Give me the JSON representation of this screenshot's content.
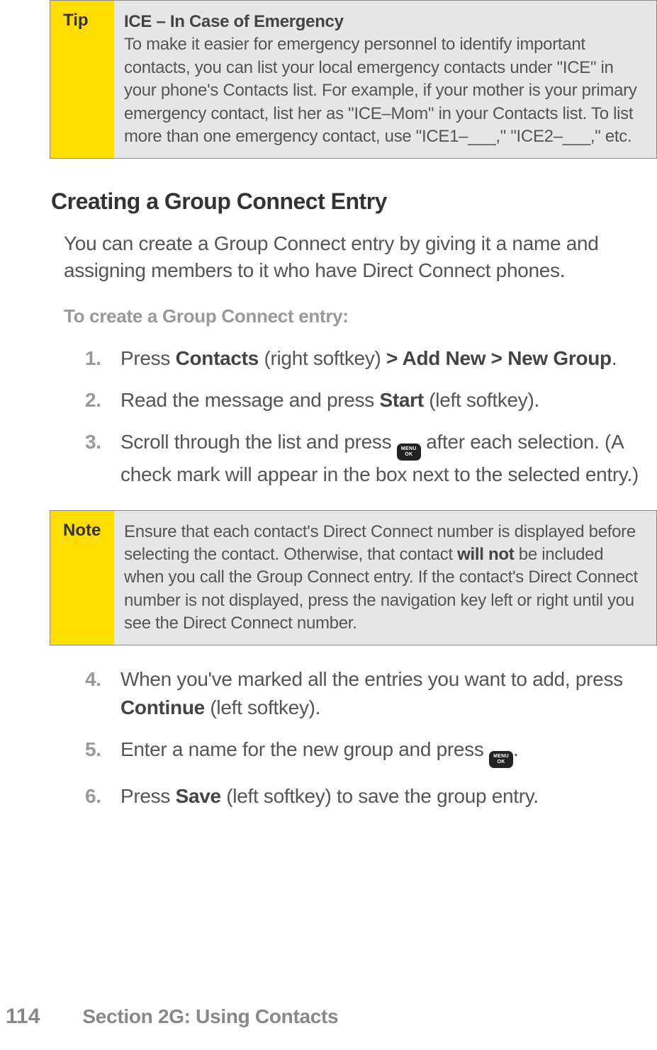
{
  "tip": {
    "label": "Tip",
    "title": "ICE – In Case of Emergency",
    "body": "To make it easier for emergency personnel to identify important contacts, you can list your local emergency contacts under \"ICE\" in your phone's Contacts list. For example, if your mother is your primary emergency contact, list her as \"ICE–Mom\" in your Contacts list. To list more than one emergency contact, use \"ICE1–___,\" \"ICE2–___,\" etc."
  },
  "heading": "Creating a Group Connect Entry",
  "intro": "You can create a Group Connect entry by giving it a name and assigning members to it who have Direct Connect phones.",
  "subhead": "To create a Group Connect entry:",
  "steps_a": [
    {
      "num": "1.",
      "pre": "Press ",
      "b1": "Contacts",
      "mid": " (right softkey) ",
      "b2": "> Add New > New Group",
      "post": "."
    },
    {
      "num": "2.",
      "pre": "Read the message and press ",
      "b1": "Start",
      "mid": " (left softkey).",
      "b2": "",
      "post": ""
    },
    {
      "num": "3.",
      "pre": "Scroll through the list and press ",
      "icon": true,
      "post": " after each selection. (A check mark will appear in the box next to the selected entry.)"
    }
  ],
  "note": {
    "label": "Note",
    "pre": "Ensure that each contact's Direct Connect number is displayed before selecting the contact. Otherwise, that contact ",
    "bold": "will not",
    "post": " be included when you call the Group Connect entry.  If the contact's Direct Connect number is not displayed, press the navigation key left or right until you see the Direct Connect number."
  },
  "steps_b": [
    {
      "num": "4.",
      "pre": "When you've marked all the entries you want to add, press ",
      "b1": "Continue",
      "post": " (left softkey)."
    },
    {
      "num": "5.",
      "pre": "Enter a name for the new group and press ",
      "icon": true,
      "post": "."
    },
    {
      "num": "6.",
      "pre": "Press ",
      "b1": "Save",
      "post": " (left softkey) to save the group entry."
    }
  ],
  "menu_ok": {
    "line1": "MENU",
    "line2": "OK"
  },
  "footer": {
    "page": "114",
    "section": "Section 2G: Using Contacts"
  }
}
